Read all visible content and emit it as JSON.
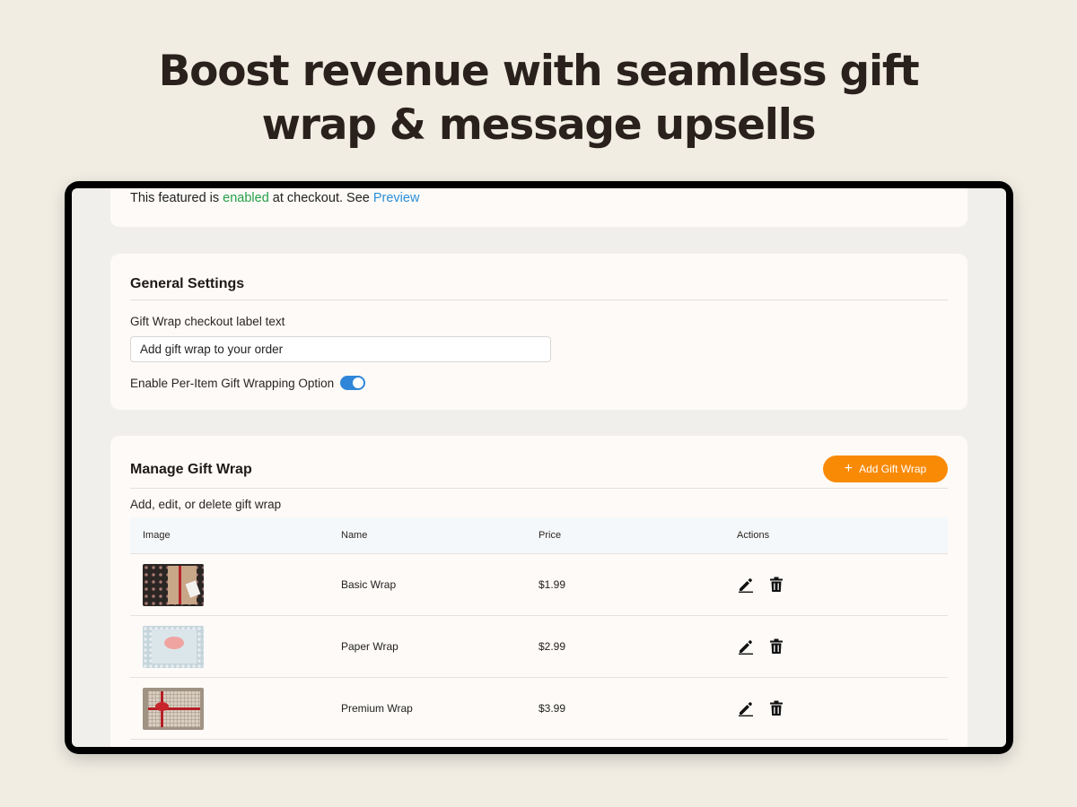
{
  "headline": {
    "line1": "Boost revenue with seamless gift",
    "line2": "wrap & message upsells"
  },
  "status": {
    "text_before": "This featured is ",
    "enabled_word": "enabled",
    "text_middle": " at checkout. See ",
    "link": "Preview"
  },
  "general": {
    "title": "General Settings",
    "label_text": "Gift Wrap checkout label text",
    "label_value": "Add gift wrap to your order",
    "toggle_label": "Enable Per-Item Gift Wrapping Option",
    "toggle_on": true
  },
  "manage": {
    "title": "Manage Gift Wrap",
    "add_button": "Add Gift Wrap",
    "subtitle": "Add, edit, or delete gift wrap",
    "columns": [
      "Image",
      "Name",
      "Price",
      "Actions"
    ],
    "rows": [
      {
        "name": "Basic Wrap",
        "price": "$1.99"
      },
      {
        "name": "Paper Wrap",
        "price": "$2.99"
      },
      {
        "name": "Premium Wrap",
        "price": "$3.99"
      }
    ]
  },
  "colors": {
    "page_bg": "#f1ede3",
    "accent_orange": "#f98a06",
    "enabled_green": "#25a04a",
    "link_blue": "#2b8fd9",
    "toggle_blue": "#2f86d9"
  },
  "icons": [
    "plus-icon",
    "edit-pencil-icon",
    "trash-icon"
  ]
}
